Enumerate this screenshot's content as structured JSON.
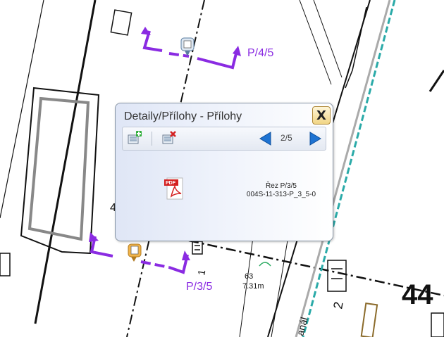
{
  "map": {
    "labels": {
      "section_top": "P/4/5",
      "section_bottom": "P/3/5",
      "number_large": "44",
      "number_1": "1",
      "number_2": "2",
      "number_4": "4",
      "dimension_a": "63",
      "dimension_b": "7.31m",
      "canal_label": "anál"
    }
  },
  "popup": {
    "title": "Detaily/Přílohy - Přílohy",
    "close_label": "X",
    "toolbar": {
      "add_icon": "add-attachment-icon",
      "remove_icon": "remove-attachment-icon",
      "page_indicator": "2/5"
    },
    "attachment": {
      "icon": "pdf-file-icon",
      "name_line1": "Řez P/3/5",
      "name_line2": "004S-11-313-P_3_5-0"
    }
  },
  "colors": {
    "section_marker": "#8a2be2",
    "teal_boundary": "#2aaaa8",
    "popup_border": "#8b98a8",
    "nav_arrow": "#1e73d2"
  }
}
